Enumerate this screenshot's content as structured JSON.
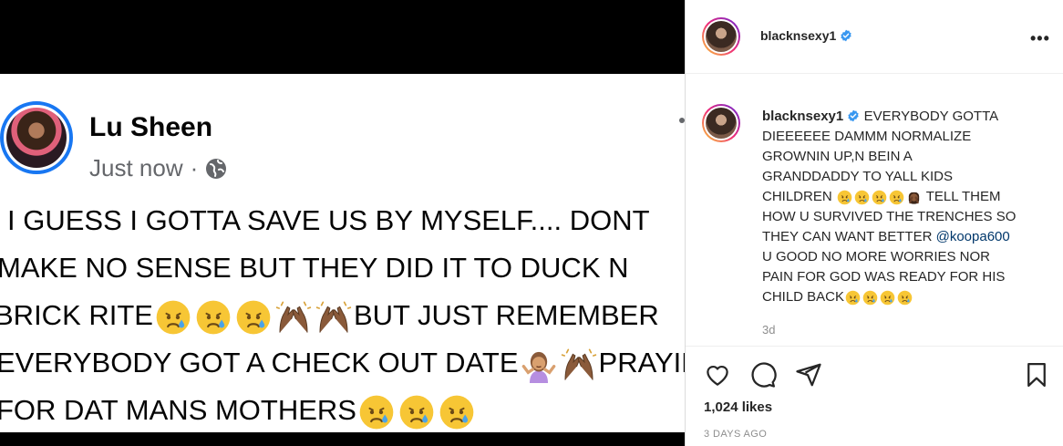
{
  "post_image": {
    "author_name": "Lu Sheen",
    "timestamp": "Just now",
    "separator": "·",
    "lines": [
      {
        "text": "I GUESS I GOTTA SAVE US BY MYSELF.... DONT",
        "emoji_after": []
      },
      {
        "text": "MAKE NO SENSE BUT THEY DID IT TO DUCK N",
        "emoji_after": []
      },
      {
        "text": "BRICK RITE",
        "emoji_after": [
          "sad-relieved",
          "sad-relieved",
          "sad-relieved",
          "raised-hands",
          "raised-hands"
        ],
        "text_after": "BUT JUST REMEMBER"
      },
      {
        "text": "EVERYBODY GOT A CHECK OUT DATE",
        "emoji_after": [
          "shrug-woman",
          "raised-hands"
        ],
        "text_after": "PRAYIN"
      },
      {
        "text": "FOR DAT MANS MOTHERS",
        "emoji_after": [
          "sad-relieved",
          "sad-relieved",
          "sad-relieved"
        ]
      }
    ]
  },
  "header": {
    "username": "blacknsexy1",
    "more_label": "•••"
  },
  "caption": {
    "username": "blacknsexy1",
    "line1": "EVERYBODY GOTTA",
    "line2": "DIEEEEEE DAMMM NORMALIZE",
    "line3": "GROWNIN UP,N BEIN A",
    "line4": "GRANDDADDY TO YALL KIDS",
    "line5_text": "CHILDREN",
    "line5_after": "TELL THEM",
    "line6": "HOW U SURVIVED THE TRENCHES SO",
    "line7_text": "THEY CAN WANT BETTER",
    "mention": "@koopa600",
    "line8": "U GOOD NO MORE WORRIES NOR",
    "line9": "PAIN FOR GOD WAS READY FOR HIS",
    "line10_text": "CHILD BACK",
    "time": "3d"
  },
  "actions": {
    "likes": "1,024 likes",
    "date": "3 DAYS AGO"
  },
  "colors": {
    "facebook_blue": "#1877f2",
    "instagram_verified": "#3897f0",
    "text_primary": "#262626",
    "text_secondary": "#8e8e8e",
    "mention": "#00376b"
  }
}
